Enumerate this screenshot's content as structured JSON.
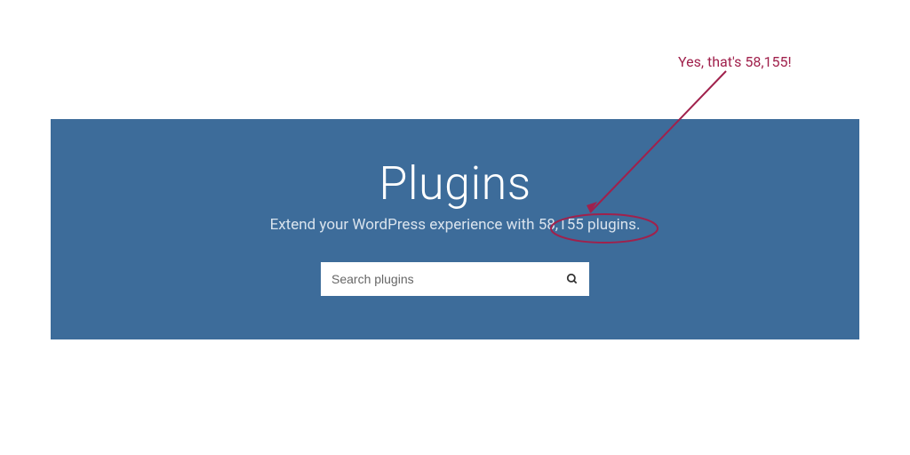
{
  "banner": {
    "title": "Plugins",
    "subtitle_prefix": "Extend your WordPress experience with ",
    "plugin_count": "58,155",
    "subtitle_suffix": " plugins."
  },
  "search": {
    "placeholder": "Search plugins"
  },
  "annotation": {
    "text": "Yes, that's 58,155!"
  },
  "colors": {
    "banner_bg": "#3d6c9a",
    "annotation": "#a0214c"
  }
}
